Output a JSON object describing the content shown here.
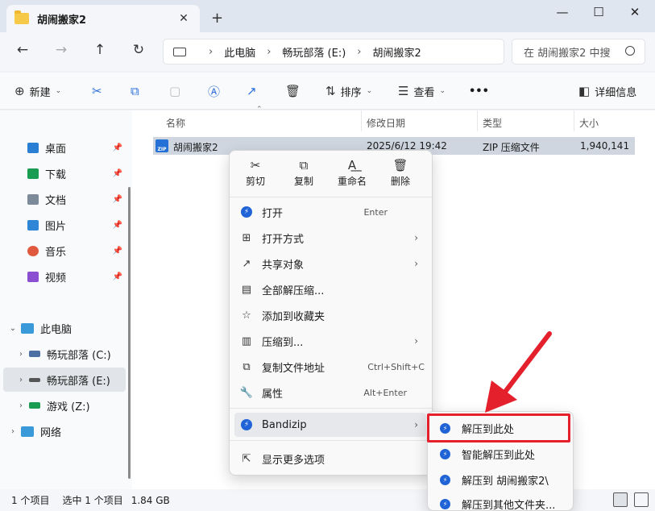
{
  "window": {
    "tab_title": "胡闹搬家2",
    "close_tab": "✕",
    "new_tab": "+",
    "minimize": "—",
    "maximize": "☐",
    "close": "✕"
  },
  "nav": {
    "back": "←",
    "forward": "→",
    "up": "↑",
    "refresh": "↻",
    "breadcrumb": [
      "此电脑",
      "畅玩部落 (E:)",
      "胡闹搬家2"
    ],
    "search_placeholder": "在 胡闹搬家2 中搜"
  },
  "toolbar": {
    "new_label": "新建",
    "sort_label": "排序",
    "view_label": "查看",
    "more_label": "•••",
    "details_label": "详细信息"
  },
  "sidebar": {
    "quick": [
      {
        "label": "桌面",
        "color": "#2a7fd4"
      },
      {
        "label": "下载",
        "color": "#1a9c52"
      },
      {
        "label": "文档",
        "color": "#7d8a99"
      },
      {
        "label": "图片",
        "color": "#2f86d6"
      },
      {
        "label": "音乐",
        "color": "#e0593e"
      },
      {
        "label": "视频",
        "color": "#8b4fd1"
      }
    ],
    "this_pc": "此电脑",
    "drives": [
      {
        "label": "畅玩部落 (C:)"
      },
      {
        "label": "畅玩部落 (E:)"
      },
      {
        "label": "游戏 (Z:)"
      }
    ],
    "network": "网络"
  },
  "columns": {
    "name": "名称",
    "modified": "修改日期",
    "type": "类型",
    "size": "大小"
  },
  "file": {
    "name": "胡闹搬家2",
    "modified": "2025/6/12 19:42",
    "type": "ZIP 压缩文件",
    "size": "1,940,141",
    "icon_text": "ZIP"
  },
  "context_menu": {
    "quick_actions": [
      {
        "label": "剪切",
        "icon": "✂"
      },
      {
        "label": "复制",
        "icon": "⧉"
      },
      {
        "label": "重命名",
        "icon": "A͟"
      },
      {
        "label": "删除",
        "icon": "🗑"
      }
    ],
    "items": [
      {
        "label": "打开",
        "shortcut": "Enter",
        "icon": "bz"
      },
      {
        "label": "打开方式",
        "arrow": "›",
        "icon": "⊞"
      },
      {
        "label": "共享对象",
        "arrow": "›",
        "icon": "↗"
      },
      {
        "label": "全部解压缩...",
        "icon": "▤"
      },
      {
        "label": "添加到收藏夹",
        "icon": "☆"
      },
      {
        "label": "压缩到...",
        "arrow": "›",
        "icon": "▥"
      },
      {
        "label": "复制文件地址",
        "shortcut": "Ctrl+Shift+C",
        "icon": "⧉"
      },
      {
        "label": "属性",
        "shortcut": "Alt+Enter",
        "icon": "🔧"
      },
      {
        "label": "Bandizip",
        "arrow": "›",
        "icon": "bz"
      },
      {
        "label": "显示更多选项",
        "icon": "⇱"
      }
    ]
  },
  "submenu": {
    "items": [
      {
        "label": "解压到此处"
      },
      {
        "label": "智能解压到此处"
      },
      {
        "label": "解压到 胡闹搬家2\\"
      },
      {
        "label": "解压到其他文件夹..."
      }
    ]
  },
  "status": {
    "items": "1 个项目",
    "selected": "选中 1 个项目",
    "size": "1.84 GB"
  },
  "colors": {
    "accent": "#2470d6",
    "highlight_box": "#e3202b",
    "selection": "#cfd6e0"
  }
}
